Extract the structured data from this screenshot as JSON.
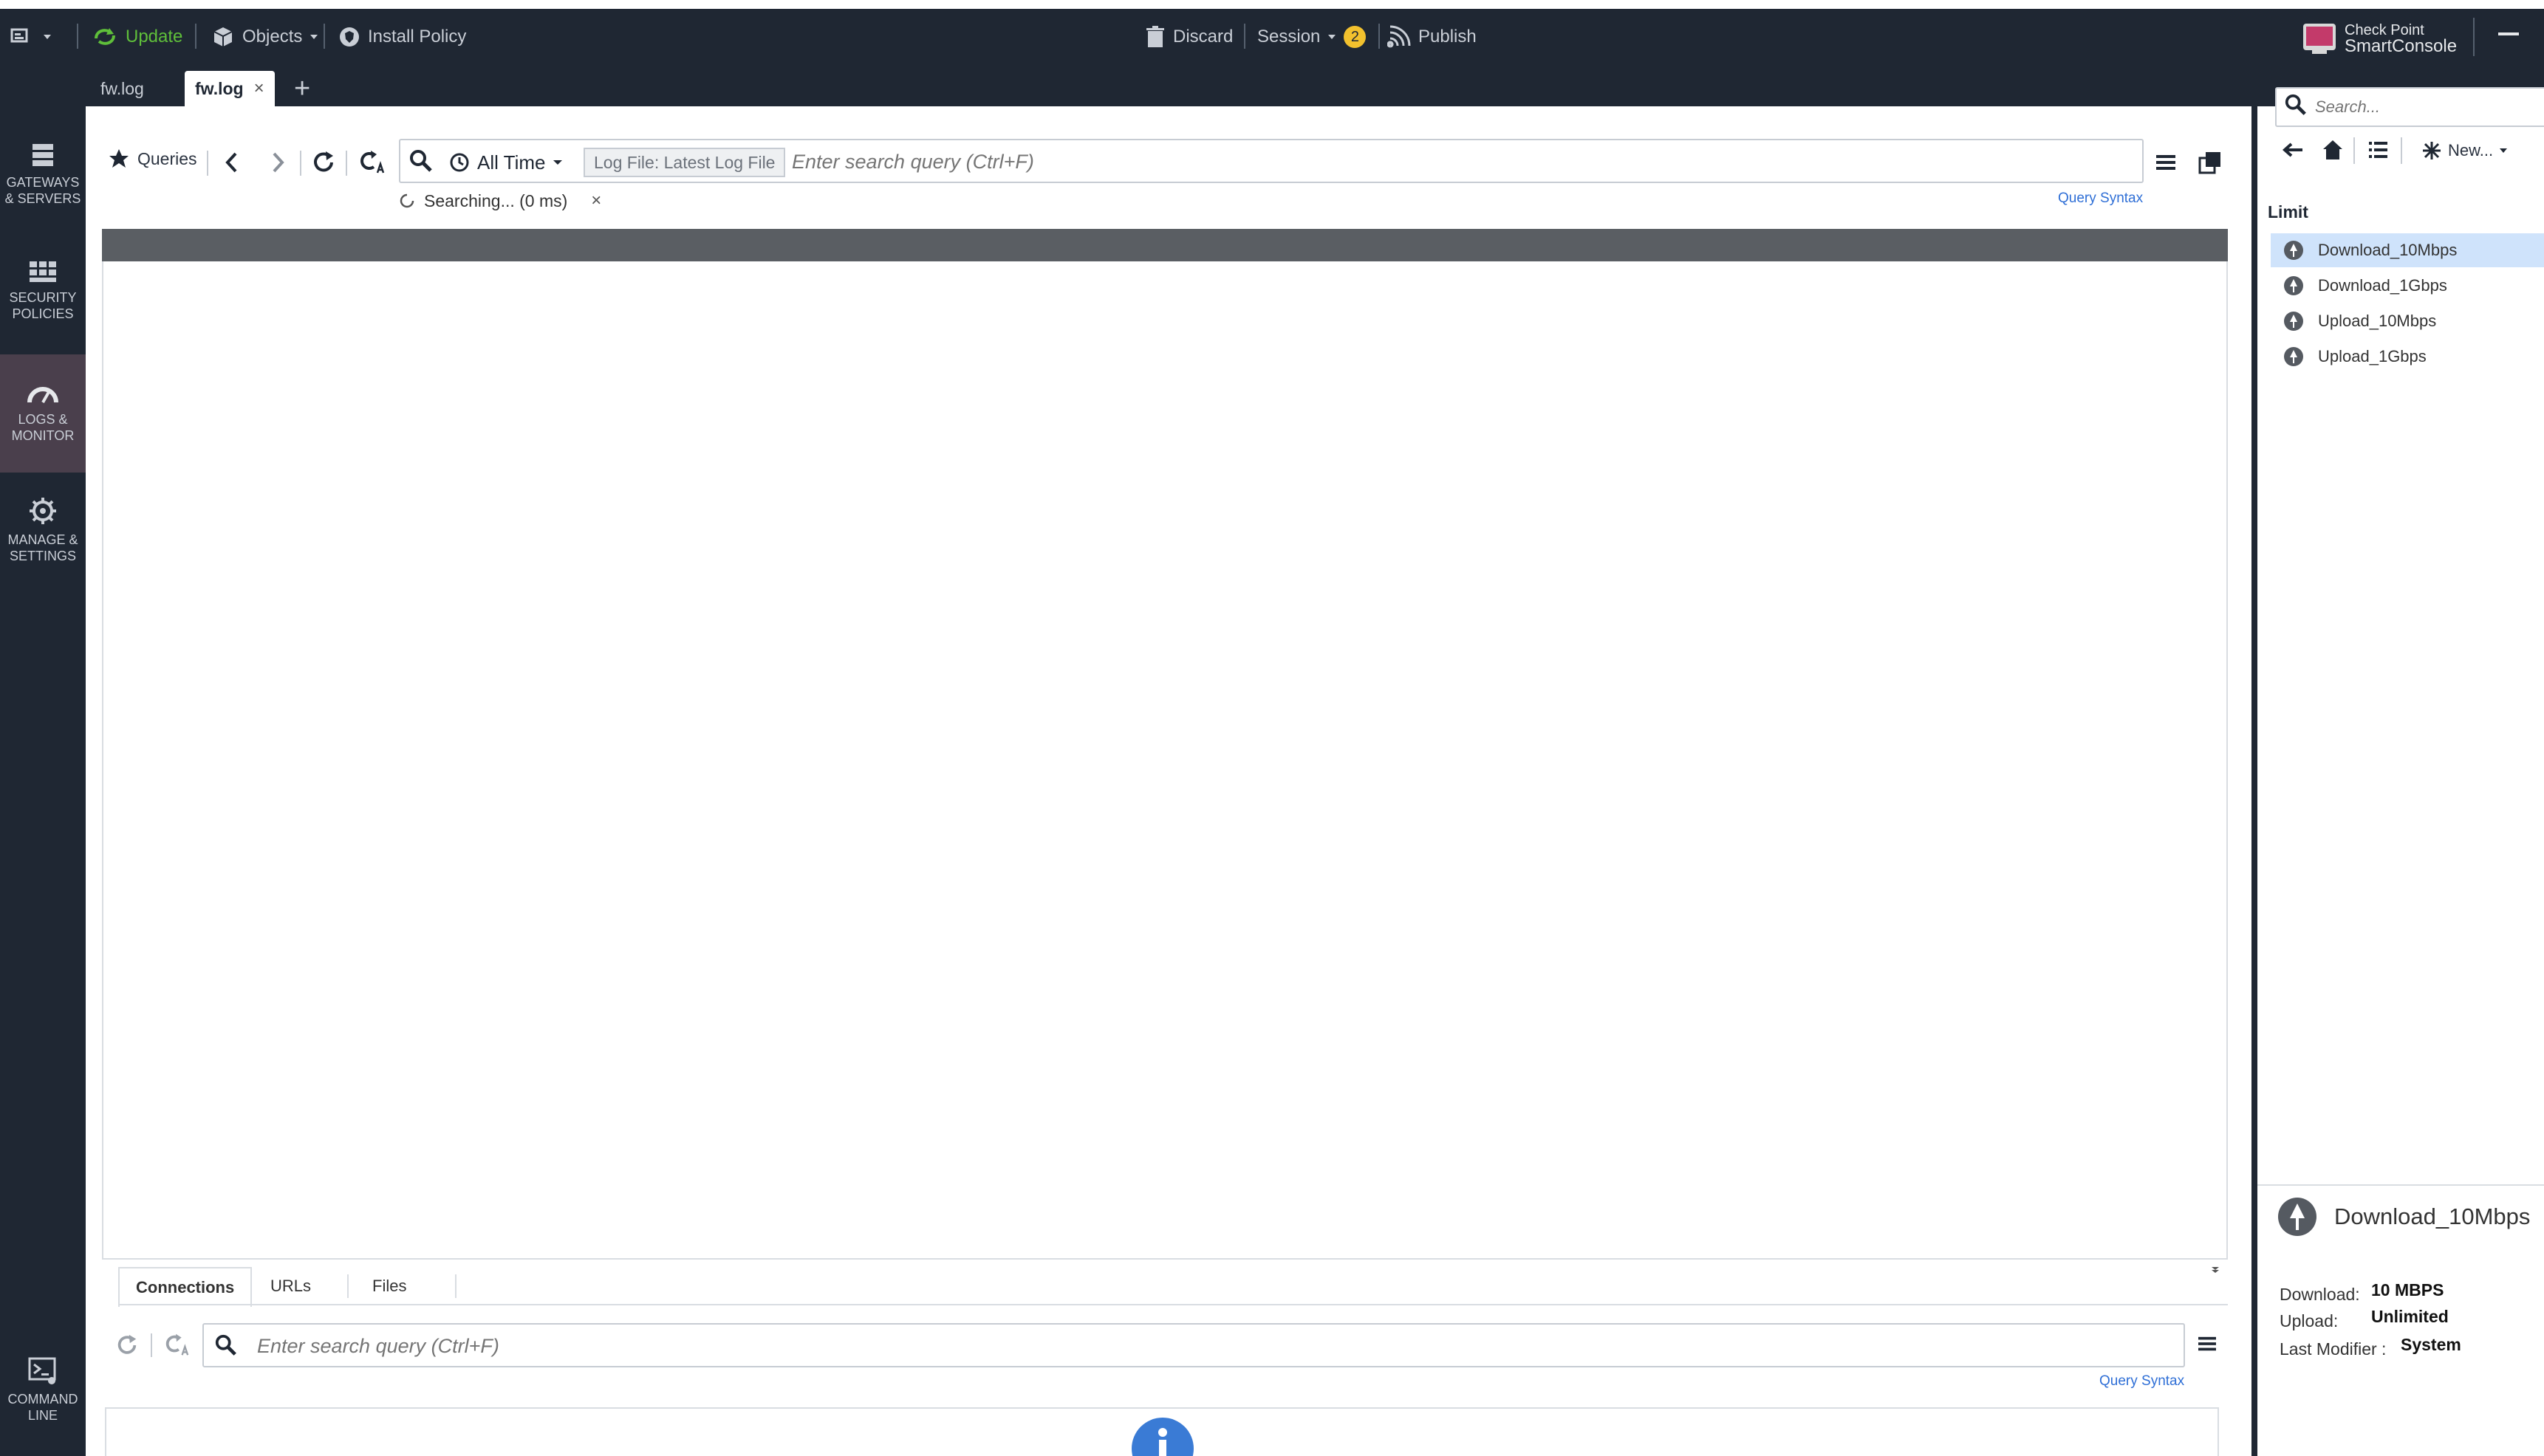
{
  "topbar": {
    "update_label": "Update",
    "objects_label": "Objects",
    "install_policy_label": "Install Policy",
    "discard_label": "Discard",
    "session_label": "Session",
    "session_badge": "2",
    "publish_label": "Publish",
    "brand_line1": "Check Point",
    "brand_line2": "SmartConsole"
  },
  "tabs": [
    {
      "label": "fw.log"
    },
    {
      "label": "fw.log"
    }
  ],
  "tab_close": "×",
  "tab_add": "+",
  "leftnav": [
    {
      "label_line1": "GATEWAYS",
      "label_line2": "& SERVERS"
    },
    {
      "label_line1": "SECURITY",
      "label_line2": "POLICIES"
    },
    {
      "label_line1": "LOGS &",
      "label_line2": "MONITOR"
    },
    {
      "label_line1": "MANAGE &",
      "label_line2": "SETTINGS"
    },
    {
      "label_line1": "COMMAND",
      "label_line2": "LINE"
    }
  ],
  "logs_toolbar": {
    "queries_label": "Queries",
    "time_filter": "All Time",
    "log_file_tag": "Log File: Latest Log File",
    "search_placeholder": "Enter search query (Ctrl+F)",
    "searching_status": "Searching... (0 ms)",
    "cancel_glyph": "×",
    "query_syntax": "Query Syntax"
  },
  "bottom": {
    "tabs": [
      {
        "label": "Connections"
      },
      {
        "label": "URLs"
      },
      {
        "label": "Files"
      }
    ],
    "search_placeholder": "Enter search query (Ctrl+F)",
    "query_syntax": "Query Syntax"
  },
  "right_panel": {
    "search_placeholder": "Search...",
    "new_label": "New...",
    "section_title": "Limit",
    "items": [
      {
        "label": "Download_10Mbps",
        "selected": true
      },
      {
        "label": "Download_1Gbps",
        "selected": false
      },
      {
        "label": "Upload_10Mbps",
        "selected": false
      },
      {
        "label": "Upload_1Gbps",
        "selected": false
      }
    ],
    "detail": {
      "title": "Download_10Mbps",
      "download_label": "Download:",
      "download_value": "10 MBPS",
      "upload_label": "Upload:",
      "upload_value": "Unlimited",
      "modifier_label": "Last Modifier :",
      "modifier_value": "System"
    }
  },
  "colors": {
    "dark": "#1f2733",
    "accent_green": "#5fbf3a",
    "badge": "#f2c12e",
    "selected_row": "#cfe3fb",
    "link": "#2f6fd6",
    "info": "#3a7bd5"
  }
}
